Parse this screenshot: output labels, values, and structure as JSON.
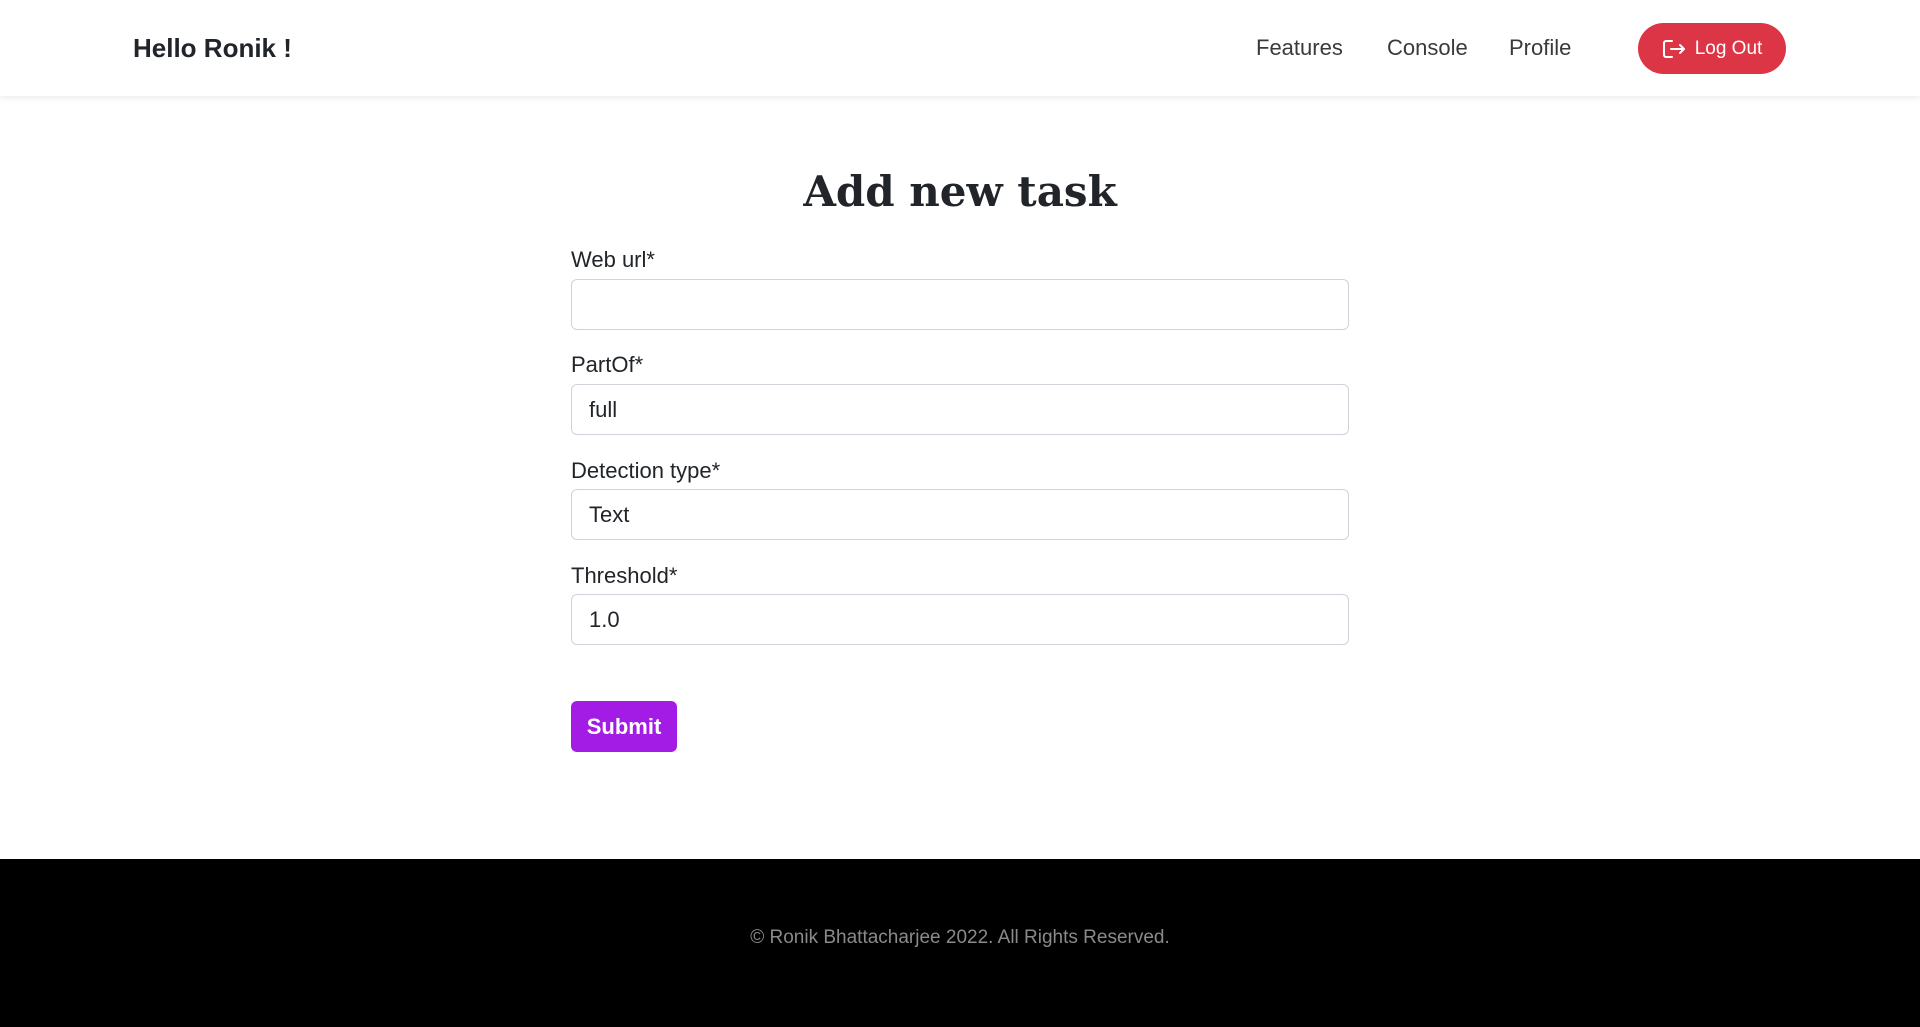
{
  "navbar": {
    "brand": "Hello Ronik !",
    "links": [
      "Features",
      "Console",
      "Profile"
    ],
    "logout_label": "Log Out",
    "logout_color": "#dc3545"
  },
  "form": {
    "title": "Add new task",
    "fields": [
      {
        "label": "Web url*",
        "value": ""
      },
      {
        "label": "PartOf*",
        "value": "full"
      },
      {
        "label": "Detection type*",
        "value": "Text"
      },
      {
        "label": "Threshold*",
        "value": "1.0"
      }
    ],
    "submit_label": "Submit",
    "submit_color": "#a21ce6"
  },
  "footer": {
    "text": "© Ronik Bhattacharjee 2022. All Rights Reserved."
  }
}
